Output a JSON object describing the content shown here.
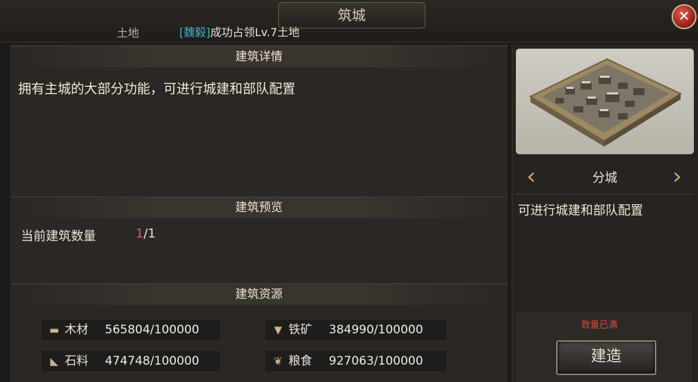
{
  "header": {
    "title": "筑城",
    "tab_land": "土地",
    "notice_name": "[魏毅]",
    "notice_text": "成功占领Lv.7土地"
  },
  "details": {
    "heading": "建筑详情",
    "description": "拥有主城的大部分功能，可进行城建和部队配置"
  },
  "preview": {
    "heading": "建筑预览",
    "count_label": "当前建筑数量",
    "count_current": "1",
    "count_total": "/1"
  },
  "resources": {
    "heading": "建筑资源",
    "items": [
      {
        "icon": "wood-icon",
        "label": "木材",
        "value": "565804/100000"
      },
      {
        "icon": "iron-icon",
        "label": "铁矿",
        "value": "384990/100000"
      },
      {
        "icon": "stone-icon",
        "label": "石料",
        "value": "474748/100000"
      },
      {
        "icon": "grain-icon",
        "label": "粮食",
        "value": "927063/100000"
      }
    ]
  },
  "side": {
    "building_name": "分城",
    "building_desc": "可进行城建和部队配置",
    "status": "数量已满",
    "build_label": "建造"
  },
  "colors": {
    "accent_name": "#3ab2d0",
    "warning": "#d64a3e",
    "count_current": "#e4574a"
  }
}
